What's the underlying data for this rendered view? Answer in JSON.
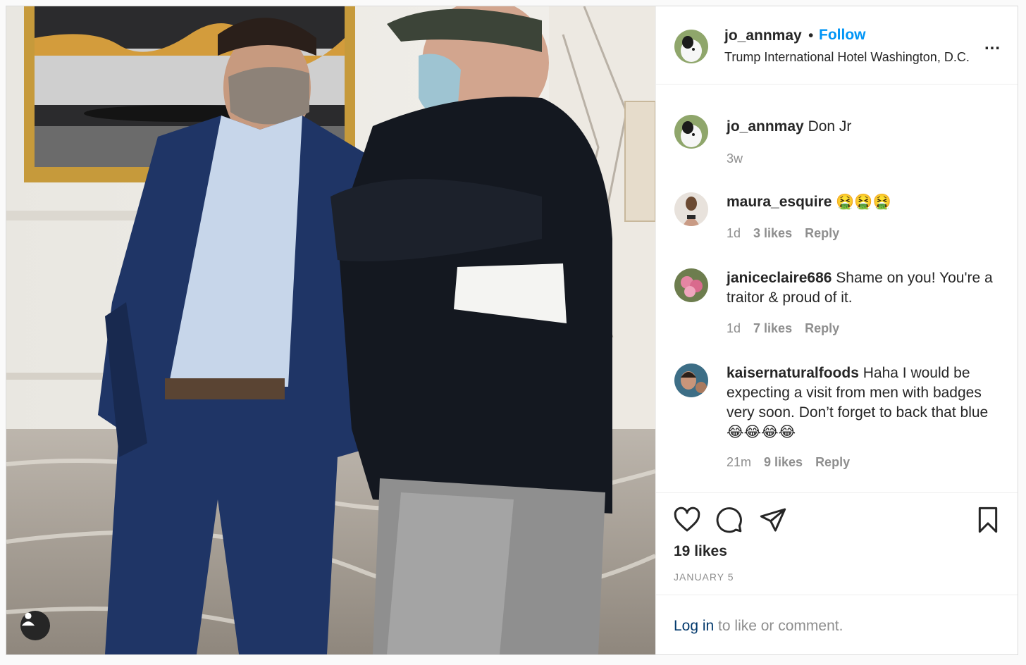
{
  "post": {
    "author": "jo_annmay",
    "separator": "•",
    "follow_label": "Follow",
    "location": "Trump International Hotel Washington, D.C.",
    "more_label": "..."
  },
  "comments": [
    {
      "user": "jo_annmay",
      "text": "Don Jr",
      "time": "3w",
      "likes": "",
      "reply": ""
    },
    {
      "user": "maura_esquire",
      "text": "🤮🤮🤮",
      "time": "1d",
      "likes": "3 likes",
      "reply": "Reply"
    },
    {
      "user": "janiceclaire686",
      "text": "Shame on you! You're a traitor & proud of it.",
      "time": "1d",
      "likes": "7 likes",
      "reply": "Reply"
    },
    {
      "user": "kaisernaturalfoods",
      "text": "Haha I would be expecting a visit from men with badges very soon. Don’t forget to back that blue 😂😂😂😂",
      "time": "21m",
      "likes": "9 likes",
      "reply": "Reply"
    }
  ],
  "footer": {
    "likes": "19 likes",
    "date": "JANUARY 5",
    "login_link": "Log in",
    "login_rest": " to like or comment."
  },
  "icons": [
    "heart-icon",
    "comment-icon",
    "share-icon",
    "bookmark-icon",
    "user-tag-icon"
  ],
  "colors": {
    "accent": "#0095f6",
    "muted": "#8e8e8e",
    "text": "#262626",
    "link": "#00376b"
  }
}
